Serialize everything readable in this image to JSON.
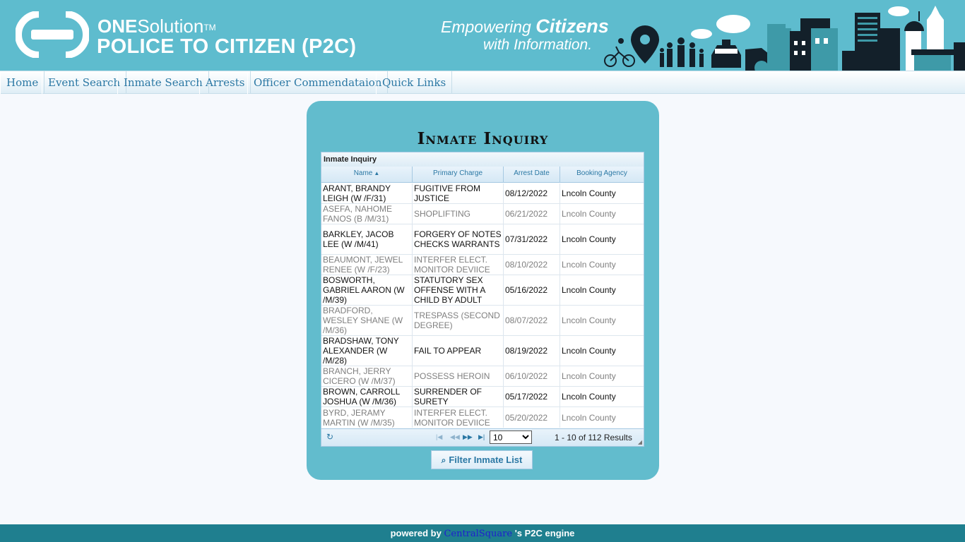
{
  "header": {
    "brand_one": "ONE",
    "brand_solution": "Solution",
    "brand_tm": "TM",
    "brand_subtitle": "POLICE TO CITIZEN (P2C)",
    "tagline_empowering": "Empowering",
    "tagline_citizens": "Citizens",
    "tagline_line2": "with Information."
  },
  "nav": {
    "items": [
      "Home",
      "Event Search",
      "Inmate Search",
      "Arrests",
      "Officer Commendataion",
      "Quick Links"
    ]
  },
  "panel": {
    "title": "Inmate Inquiry"
  },
  "grid": {
    "caption": "Inmate Inquiry",
    "columns": [
      "Name",
      "Primary Charge",
      "Arrest Date",
      "Booking Agency"
    ],
    "rows": [
      {
        "name": "ARANT, BRANDY LEIGH (W /F/31)",
        "charge": "FUGITIVE FROM JUSTICE",
        "date": "08/12/2022",
        "agency": "Lncoln County"
      },
      {
        "name": "ASEFA, NAHOME FANOS (B /M/31)",
        "charge": "SHOPLIFTING",
        "date": "06/21/2022",
        "agency": "Lncoln County"
      },
      {
        "name": "BARKLEY, JACOB LEE (W /M/41)",
        "charge": "FORGERY OF NOTES CHECKS WARRANTS",
        "date": "07/31/2022",
        "agency": "Lncoln County"
      },
      {
        "name": "BEAUMONT, JEWEL RENEE (W /F/23)",
        "charge": "INTERFER ELECT. MONITOR DEVIICE",
        "date": "08/10/2022",
        "agency": "Lncoln County"
      },
      {
        "name": "BOSWORTH, GABRIEL AARON (W /M/39)",
        "charge": "STATUTORY SEX OFFENSE WITH A CHILD BY ADULT",
        "date": "05/16/2022",
        "agency": "Lncoln County"
      },
      {
        "name": "BRADFORD, WESLEY SHANE (W /M/36)",
        "charge": "TRESPASS (SECOND DEGREE)",
        "date": "08/07/2022",
        "agency": "Lncoln County"
      },
      {
        "name": "BRADSHAW, TONY ALEXANDER (W /M/28)",
        "charge": "FAIL TO APPEAR",
        "date": "08/19/2022",
        "agency": "Lncoln County"
      },
      {
        "name": "BRANCH, JERRY CICERO (W /M/37)",
        "charge": "POSSESS HEROIN",
        "date": "06/10/2022",
        "agency": "Lncoln County"
      },
      {
        "name": "BROWN, CARROLL JOSHUA (W /M/36)",
        "charge": "SURRENDER OF SURETY",
        "date": "05/17/2022",
        "agency": "Lncoln County"
      },
      {
        "name": "BYRD, JERAMY MARTIN (W /M/35)",
        "charge": "INTERFER ELECT. MONITOR DEVIICE",
        "date": "05/20/2022",
        "agency": "Lncoln County"
      }
    ],
    "pager": {
      "page_size": "10",
      "page_size_options": [
        "10"
      ],
      "results_text": "1 - 10 of 112 Results"
    }
  },
  "filter_button": "Filter Inmate List",
  "footer": {
    "powered_by": "powered by",
    "link": "CentralSquare",
    "suffix": "'s P2C engine"
  },
  "colors": {
    "header_bg": "#5ebcce",
    "panel_bg": "#62bccd",
    "nav_text": "#2b78a4",
    "footer_bg": "#1f7f8f"
  }
}
